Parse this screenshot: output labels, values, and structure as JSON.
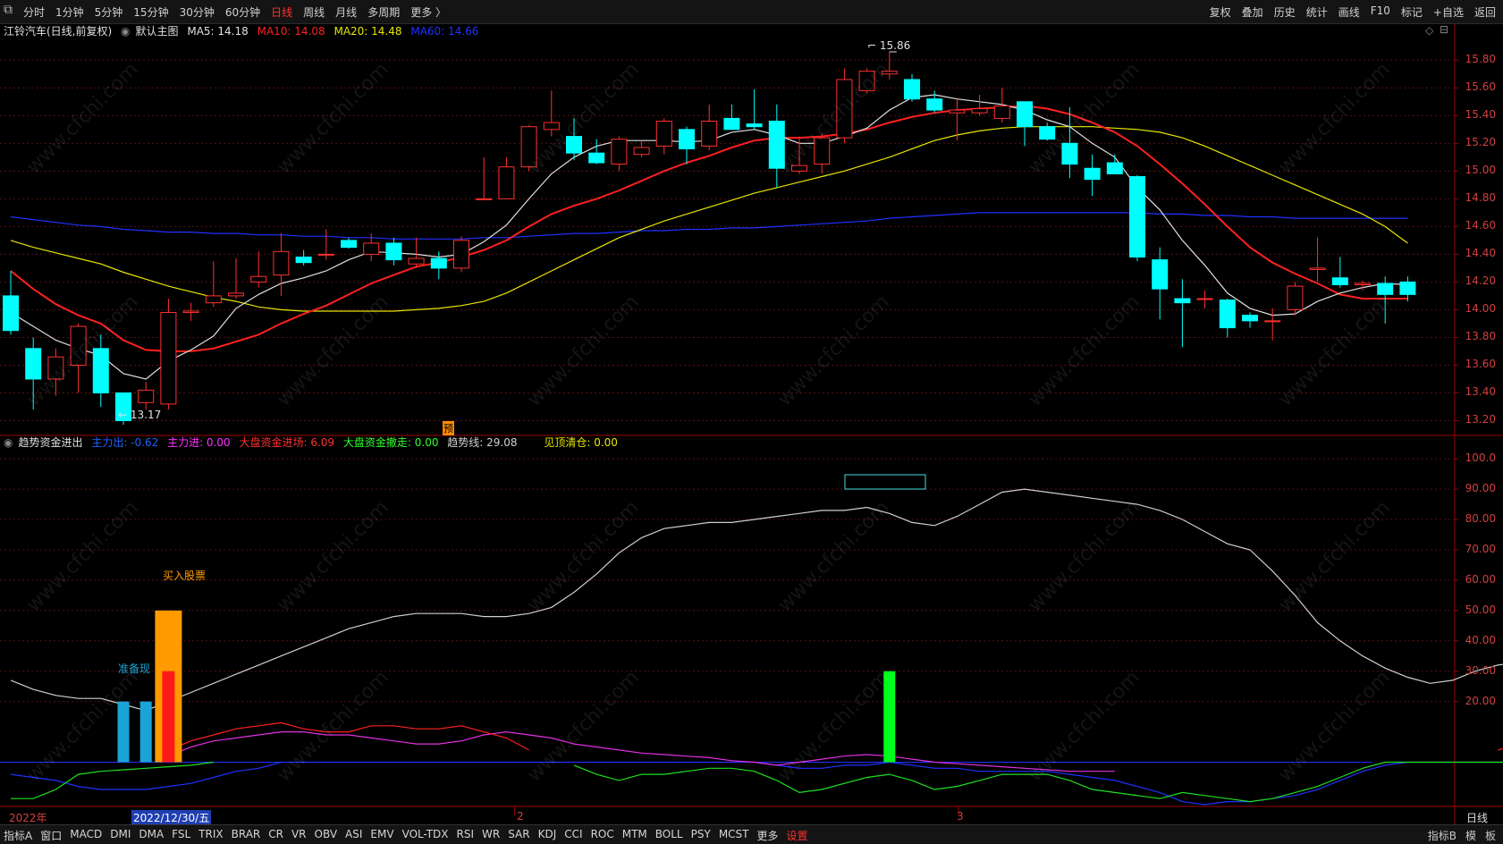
{
  "toolbar": {
    "periods": [
      "分时",
      "1分钟",
      "5分钟",
      "15分钟",
      "30分钟",
      "60分钟",
      "日线",
      "周线",
      "月线",
      "多周期",
      "更多 〉"
    ],
    "active_period": "日线",
    "right_buttons": [
      "复权",
      "叠加",
      "历史",
      "统计",
      "画线",
      "F10",
      "标记",
      "+自选",
      "返回"
    ]
  },
  "main_chart": {
    "stock_title": "江铃汽车(日线,前复权)",
    "template": "默认主图",
    "ma5_label": "MA5: 14.18",
    "ma10_label": "MA10: 14.08",
    "ma20_label": "MA20: 14.48",
    "ma60_label": "MA60: 14.66",
    "high_label": "15.86",
    "low_label": "13.17",
    "forecast_marker": "预",
    "y_ticks": [
      "15.80",
      "15.60",
      "15.40",
      "15.20",
      "15.00",
      "14.80",
      "14.60",
      "14.40",
      "14.20",
      "14.00",
      "13.80",
      "13.60",
      "13.40",
      "13.20"
    ]
  },
  "indicator": {
    "name": "趋势资金进出",
    "main_out": "主力出: -0.62",
    "main_in": "主力进: 0.00",
    "market_in": "大盘资金进场: 6.09",
    "market_out": "大盘资金撤走: 0.00",
    "trend": "趋势线: 29.08",
    "top_clear": "见顶清仓: 0.00",
    "buy_label": "买入股票",
    "ready_label": "准备现",
    "y_ticks": [
      "100.0",
      "90.00",
      "80.00",
      "70.00",
      "60.00",
      "50.00",
      "40.00",
      "30.00",
      "20.00"
    ]
  },
  "time_axis": {
    "year": "2022年",
    "cursor_date": "2022/12/30/五",
    "month_2": "2",
    "month_3": "3"
  },
  "bottom_tabs": [
    "指标A",
    "窗口",
    "MACD",
    "DMI",
    "DMA",
    "FSL",
    "TRIX",
    "BRAR",
    "CR",
    "VR",
    "OBV",
    "ASI",
    "EMV",
    "VOL-TDX",
    "RSI",
    "WR",
    "SAR",
    "KDJ",
    "CCI",
    "ROC",
    "MTM",
    "BOLL",
    "PSY",
    "MCST",
    "更多",
    "设置"
  ],
  "bottom_right": [
    "指标B",
    "模",
    "板"
  ],
  "period_right": "日线",
  "watermark": "www.cfchi.com",
  "colors": {
    "up": "#ff3030",
    "down": "#00ffff",
    "ma5": "#e0e0e0",
    "ma10": "#ff2020",
    "ma20": "#e6e600",
    "ma60": "#2030ff"
  },
  "chart_data": {
    "type": "candlestick",
    "candles": [
      {
        "o": 14.1,
        "h": 14.28,
        "l": 13.82,
        "c": 13.85
      },
      {
        "o": 13.72,
        "h": 13.8,
        "l": 13.28,
        "c": 13.5
      },
      {
        "o": 13.5,
        "h": 13.72,
        "l": 13.38,
        "c": 13.66
      },
      {
        "o": 13.6,
        "h": 13.9,
        "l": 13.4,
        "c": 13.88
      },
      {
        "o": 13.72,
        "h": 13.82,
        "l": 13.3,
        "c": 13.4
      },
      {
        "o": 13.4,
        "h": 13.4,
        "l": 13.17,
        "c": 13.2
      },
      {
        "o": 13.33,
        "h": 13.48,
        "l": 13.28,
        "c": 13.42
      },
      {
        "o": 13.32,
        "h": 14.08,
        "l": 13.28,
        "c": 13.98
      },
      {
        "o": 13.98,
        "h": 14.05,
        "l": 13.92,
        "c": 13.99
      },
      {
        "o": 14.05,
        "h": 14.35,
        "l": 14.02,
        "c": 14.1
      },
      {
        "o": 14.1,
        "h": 14.37,
        "l": 14.08,
        "c": 14.12
      },
      {
        "o": 14.2,
        "h": 14.42,
        "l": 14.16,
        "c": 14.24
      },
      {
        "o": 14.25,
        "h": 14.55,
        "l": 14.1,
        "c": 14.42
      },
      {
        "o": 14.38,
        "h": 14.43,
        "l": 14.32,
        "c": 14.34
      },
      {
        "o": 14.4,
        "h": 14.58,
        "l": 14.36,
        "c": 14.4
      },
      {
        "o": 14.5,
        "h": 14.52,
        "l": 14.44,
        "c": 14.45
      },
      {
        "o": 14.4,
        "h": 14.55,
        "l": 14.35,
        "c": 14.48
      },
      {
        "o": 14.48,
        "h": 14.52,
        "l": 14.32,
        "c": 14.36
      },
      {
        "o": 14.33,
        "h": 14.52,
        "l": 14.3,
        "c": 14.37
      },
      {
        "o": 14.37,
        "h": 14.42,
        "l": 14.22,
        "c": 14.3
      },
      {
        "o": 14.3,
        "h": 14.53,
        "l": 14.27,
        "c": 14.5
      },
      {
        "o": 14.8,
        "h": 15.1,
        "l": 14.8,
        "c": 14.8
      },
      {
        "o": 14.8,
        "h": 15.1,
        "l": 14.8,
        "c": 15.03
      },
      {
        "o": 15.03,
        "h": 15.33,
        "l": 15.0,
        "c": 15.32
      },
      {
        "o": 15.3,
        "h": 15.58,
        "l": 15.25,
        "c": 15.35
      },
      {
        "o": 15.25,
        "h": 15.38,
        "l": 15.08,
        "c": 15.13
      },
      {
        "o": 15.13,
        "h": 15.23,
        "l": 15.05,
        "c": 15.06
      },
      {
        "o": 15.05,
        "h": 15.25,
        "l": 15.0,
        "c": 15.23
      },
      {
        "o": 15.12,
        "h": 15.22,
        "l": 15.1,
        "c": 15.17
      },
      {
        "o": 15.18,
        "h": 15.38,
        "l": 15.12,
        "c": 15.36
      },
      {
        "o": 15.3,
        "h": 15.32,
        "l": 15.05,
        "c": 15.16
      },
      {
        "o": 15.18,
        "h": 15.48,
        "l": 15.15,
        "c": 15.36
      },
      {
        "o": 15.38,
        "h": 15.48,
        "l": 15.3,
        "c": 15.3
      },
      {
        "o": 15.34,
        "h": 15.59,
        "l": 15.3,
        "c": 15.32
      },
      {
        "o": 15.36,
        "h": 15.48,
        "l": 14.88,
        "c": 15.02
      },
      {
        "o": 15.0,
        "h": 15.25,
        "l": 14.98,
        "c": 15.04
      },
      {
        "o": 15.05,
        "h": 15.27,
        "l": 14.98,
        "c": 15.24
      },
      {
        "o": 15.24,
        "h": 15.74,
        "l": 15.2,
        "c": 15.66
      },
      {
        "o": 15.58,
        "h": 15.74,
        "l": 15.56,
        "c": 15.72
      },
      {
        "o": 15.7,
        "h": 15.86,
        "l": 15.66,
        "c": 15.72
      },
      {
        "o": 15.66,
        "h": 15.7,
        "l": 15.5,
        "c": 15.52
      },
      {
        "o": 15.52,
        "h": 15.58,
        "l": 15.42,
        "c": 15.44
      },
      {
        "o": 15.42,
        "h": 15.52,
        "l": 15.22,
        "c": 15.44
      },
      {
        "o": 15.42,
        "h": 15.55,
        "l": 15.4,
        "c": 15.45
      },
      {
        "o": 15.38,
        "h": 15.6,
        "l": 15.35,
        "c": 15.47
      },
      {
        "o": 15.5,
        "h": 15.5,
        "l": 15.18,
        "c": 15.32
      },
      {
        "o": 15.32,
        "h": 15.35,
        "l": 15.22,
        "c": 15.23
      },
      {
        "o": 15.2,
        "h": 15.46,
        "l": 14.95,
        "c": 15.05
      },
      {
        "o": 15.02,
        "h": 15.12,
        "l": 14.82,
        "c": 14.94
      },
      {
        "o": 15.06,
        "h": 15.12,
        "l": 14.98,
        "c": 14.98
      },
      {
        "o": 14.96,
        "h": 14.97,
        "l": 14.35,
        "c": 14.38
      },
      {
        "o": 14.36,
        "h": 14.45,
        "l": 13.93,
        "c": 14.15
      },
      {
        "o": 14.08,
        "h": 14.22,
        "l": 13.73,
        "c": 14.05
      },
      {
        "o": 14.08,
        "h": 14.14,
        "l": 14.01,
        "c": 14.08
      },
      {
        "o": 14.07,
        "h": 14.08,
        "l": 13.8,
        "c": 13.87
      },
      {
        "o": 13.96,
        "h": 13.98,
        "l": 13.87,
        "c": 13.92
      },
      {
        "o": 13.92,
        "h": 14.01,
        "l": 13.78,
        "c": 13.92
      },
      {
        "o": 14.0,
        "h": 14.2,
        "l": 13.96,
        "c": 14.17
      },
      {
        "o": 14.29,
        "h": 14.52,
        "l": 14.2,
        "c": 14.3
      },
      {
        "o": 14.23,
        "h": 14.38,
        "l": 14.16,
        "c": 14.18
      },
      {
        "o": 14.18,
        "h": 14.21,
        "l": 14.14,
        "c": 14.19
      },
      {
        "o": 14.19,
        "h": 14.24,
        "l": 13.9,
        "c": 14.11
      },
      {
        "o": 14.2,
        "h": 14.24,
        "l": 14.06,
        "c": 14.11
      }
    ],
    "ma5": [
      13.98,
      13.88,
      13.78,
      13.72,
      13.67,
      13.54,
      13.5,
      13.63,
      13.71,
      13.81,
      14.01,
      14.11,
      14.19,
      14.23,
      14.28,
      14.36,
      14.42,
      14.41,
      14.4,
      14.38,
      14.4,
      14.49,
      14.61,
      14.8,
      14.98,
      15.1,
      15.18,
      15.22,
      15.22,
      15.22,
      15.21,
      15.22,
      15.28,
      15.3,
      15.26,
      15.2,
      15.2,
      15.25,
      15.31,
      15.44,
      15.53,
      15.55,
      15.52,
      15.5,
      15.48,
      15.44,
      15.37,
      15.32,
      15.2,
      15.1,
      14.88,
      14.72,
      14.5,
      14.32,
      14.12,
      14.01,
      13.96,
      13.97,
      14.06,
      14.12,
      14.16,
      14.19,
      14.18
    ],
    "ma10": [
      14.28,
      14.15,
      14.04,
      13.96,
      13.9,
      13.78,
      13.71,
      13.7,
      13.7,
      13.72,
      13.77,
      13.82,
      13.9,
      13.97,
      14.03,
      14.11,
      14.19,
      14.25,
      14.31,
      14.34,
      14.38,
      14.43,
      14.5,
      14.6,
      14.69,
      14.75,
      14.8,
      14.86,
      14.93,
      15.0,
      15.06,
      15.11,
      15.17,
      15.22,
      15.24,
      15.24,
      15.25,
      15.27,
      15.3,
      15.35,
      15.39,
      15.42,
      15.44,
      15.45,
      15.46,
      15.47,
      15.45,
      15.41,
      15.35,
      15.28,
      15.18,
      15.05,
      14.91,
      14.76,
      14.6,
      14.45,
      14.34,
      14.26,
      14.19,
      14.11,
      14.08,
      14.08,
      14.08
    ],
    "ma20": [
      14.5,
      14.45,
      14.41,
      14.37,
      14.33,
      14.27,
      14.22,
      14.17,
      14.13,
      14.09,
      14.06,
      14.02,
      14.0,
      13.99,
      13.99,
      13.99,
      13.99,
      13.99,
      14.0,
      14.01,
      14.03,
      14.06,
      14.12,
      14.2,
      14.28,
      14.36,
      14.44,
      14.52,
      14.58,
      14.64,
      14.69,
      14.74,
      14.79,
      14.84,
      14.88,
      14.92,
      14.96,
      15.0,
      15.05,
      15.1,
      15.16,
      15.22,
      15.26,
      15.29,
      15.31,
      15.32,
      15.32,
      15.32,
      15.32,
      15.31,
      15.3,
      15.28,
      15.24,
      15.18,
      15.11,
      15.04,
      14.97,
      14.9,
      14.83,
      14.76,
      14.69,
      14.6,
      14.48
    ],
    "ma60": [
      14.67,
      14.65,
      14.63,
      14.61,
      14.6,
      14.58,
      14.57,
      14.56,
      14.56,
      14.55,
      14.55,
      14.54,
      14.54,
      14.53,
      14.53,
      14.52,
      14.52,
      14.51,
      14.51,
      14.51,
      14.51,
      14.52,
      14.52,
      14.53,
      14.54,
      14.55,
      14.55,
      14.56,
      14.57,
      14.57,
      14.58,
      14.58,
      14.59,
      14.59,
      14.6,
      14.61,
      14.62,
      14.63,
      14.64,
      14.66,
      14.67,
      14.68,
      14.69,
      14.7,
      14.7,
      14.7,
      14.7,
      14.7,
      14.7,
      14.7,
      14.7,
      14.69,
      14.69,
      14.68,
      14.68,
      14.67,
      14.67,
      14.66,
      14.66,
      14.66,
      14.66,
      14.66,
      14.66
    ],
    "indicator_trend": [
      27,
      24,
      22,
      21,
      21,
      19,
      17,
      20,
      23,
      26,
      29,
      32,
      35,
      38,
      41,
      44,
      46,
      48,
      49,
      49,
      49,
      48,
      48,
      49,
      51,
      56,
      62,
      69,
      74,
      77,
      78,
      79,
      79,
      80,
      81,
      82,
      83,
      83,
      84,
      82,
      79,
      78,
      81,
      85,
      89,
      90,
      89,
      88,
      87,
      86,
      85,
      83,
      80,
      76,
      72,
      70,
      63,
      55,
      46,
      40,
      35,
      31,
      28,
      26,
      27,
      30,
      32,
      33,
      33,
      32,
      29
    ],
    "indicator_red": [
      null,
      null,
      null,
      null,
      null,
      null,
      null,
      4,
      7,
      9,
      11,
      12,
      13,
      11,
      10,
      10,
      12,
      12,
      11,
      11,
      12,
      10,
      8,
      4,
      null,
      null,
      null,
      null,
      null,
      null,
      null,
      null,
      null,
      null,
      null,
      null,
      null,
      null,
      null,
      null,
      null,
      null,
      null,
      null,
      null,
      null,
      null,
      null,
      null,
      null,
      null,
      null,
      null,
      null,
      null,
      null,
      null,
      null,
      null,
      null,
      null,
      null,
      null,
      null,
      null,
      null,
      4,
      6,
      6.5,
      6.5,
      6
    ],
    "indicator_magenta": [
      null,
      null,
      null,
      null,
      null,
      null,
      null,
      2,
      5,
      7,
      8,
      9,
      10,
      10,
      9,
      9,
      8,
      7,
      6,
      6,
      7,
      9,
      10,
      9,
      8,
      6,
      5,
      4,
      3,
      2.5,
      2,
      1.5,
      0.5,
      0,
      -1,
      0,
      1,
      2,
      2.5,
      2,
      1,
      0,
      -0.5,
      -1,
      -1.5,
      -2,
      -2.5,
      -3,
      -3,
      -3,
      null,
      null,
      null,
      null,
      null,
      null,
      null,
      null,
      null,
      null,
      null,
      null,
      null,
      null,
      null,
      null,
      null,
      null,
      null,
      null,
      null
    ],
    "indicator_green": [
      -12,
      -12,
      -9,
      -4,
      -3,
      -2.5,
      -2,
      -1.5,
      -1,
      0,
      null,
      null,
      null,
      null,
      null,
      null,
      null,
      null,
      null,
      null,
      null,
      null,
      null,
      null,
      null,
      -1,
      -4,
      -6,
      -4,
      -4,
      -3,
      -2,
      -2,
      -3,
      -6,
      -10,
      -9,
      -7,
      -5,
      -4,
      -6,
      -9,
      -8,
      -6,
      -4,
      -4,
      -4,
      -6,
      -9,
      -10,
      -11,
      -12,
      -10,
      -11,
      -12,
      -13,
      -12,
      -10,
      -8,
      -5,
      -2,
      0,
      0,
      0,
      0,
      0,
      0,
      0,
      0,
      0,
      0
    ],
    "indicator_blue": [
      -4,
      -5,
      -6,
      -8,
      -9,
      -9,
      -9,
      -8,
      -7,
      -5,
      -3,
      -2,
      0,
      0,
      0,
      0,
      0,
      0,
      0,
      0,
      0,
      0,
      0,
      0,
      0,
      0,
      0,
      0,
      0,
      0,
      0,
      0,
      0,
      0,
      -1,
      -2,
      -2,
      -1,
      -1,
      0,
      -1,
      -2,
      -2,
      -3,
      -3,
      -3,
      -3,
      -4,
      -5,
      -6,
      -8,
      -10,
      -13,
      -14,
      -13,
      -13,
      -12,
      -11,
      -9,
      -6,
      -3,
      -1,
      0,
      0,
      0,
      0,
      0,
      0,
      0,
      0,
      0
    ],
    "indicator_bars": [
      {
        "i": 5,
        "v": 20,
        "color": "#1aa3d6"
      },
      {
        "i": 6,
        "v": 20,
        "color": "#1aa3d6"
      },
      {
        "i": 7,
        "v": 50,
        "color": "#ff9a00"
      },
      {
        "i": 7,
        "v": 30,
        "color": "#ff1a1a"
      },
      {
        "i": 39,
        "v": 30,
        "color": "#00ff1a"
      }
    ],
    "ylim_main": [
      13.1,
      15.95
    ],
    "ylim_indicator": [
      -14,
      103
    ]
  }
}
